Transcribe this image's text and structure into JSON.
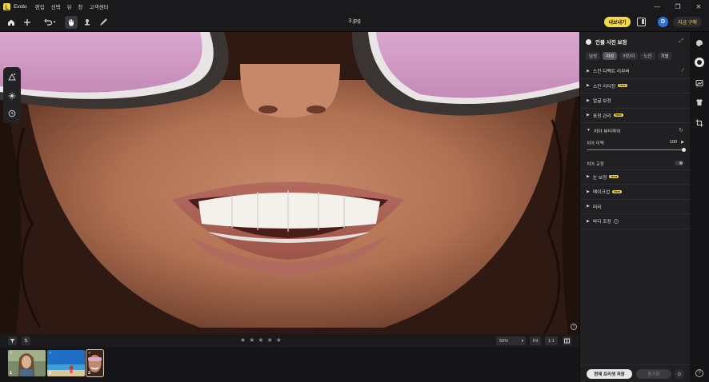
{
  "app": {
    "name": "Evoto",
    "file_name": "3.jpg"
  },
  "menu": [
    "편집",
    "선택",
    "뷰",
    "창",
    "고객센터"
  ],
  "window_controls": [
    "—",
    "❐",
    "✕"
  ],
  "toolbar": {
    "export_label": "내보내기",
    "avatar_letter": "D",
    "buy_label": "지금 구매"
  },
  "left_tools": {
    "new_badge": "NEW"
  },
  "panel": {
    "title": "인물 사진 보정",
    "chips": [
      {
        "label": "남성",
        "selected": false
      },
      {
        "label": "여성",
        "selected": true
      },
      {
        "label": "어린이",
        "selected": false
      },
      {
        "label": "노인",
        "selected": false
      },
      {
        "label": "개별",
        "selected": false
      }
    ],
    "sections_top": [
      {
        "label": "스킨 디펙트 리무버",
        "new": false,
        "icon": "magic"
      },
      {
        "label": "스킨 리터칭",
        "new": true
      },
      {
        "label": "얼굴 보정",
        "new": false
      },
      {
        "label": "표정 관리",
        "new": true
      }
    ],
    "teeth": {
      "label": "치아 뷰티파이",
      "whitening_label": "치아 미백",
      "whitening_value": "100",
      "whitening_fraction": 1.0,
      "fix_label": "치아 교정",
      "fix_on": false
    },
    "sections_bottom": [
      {
        "label": "눈 보정",
        "new": true
      },
      {
        "label": "메이크업",
        "new": true
      },
      {
        "label": "머리",
        "new": false
      },
      {
        "label": "바디 조정",
        "new": false,
        "help": true
      }
    ],
    "new_tag": "New",
    "save_preset_label": "현재 프리셋 저장",
    "sync_label": "동기화"
  },
  "bottom": {
    "rating_stars": 5,
    "zoom": "50%",
    "fit_label": "Fit",
    "one_label": "1:1"
  },
  "thumbnails": [
    {
      "num": "1",
      "selected": false,
      "checked": true
    },
    {
      "num": "2",
      "selected": false,
      "checked": true
    },
    {
      "num": "3",
      "selected": true,
      "checked": true
    }
  ],
  "colors": {
    "accent": "#f2d649",
    "avatar": "#2f6fe0"
  }
}
